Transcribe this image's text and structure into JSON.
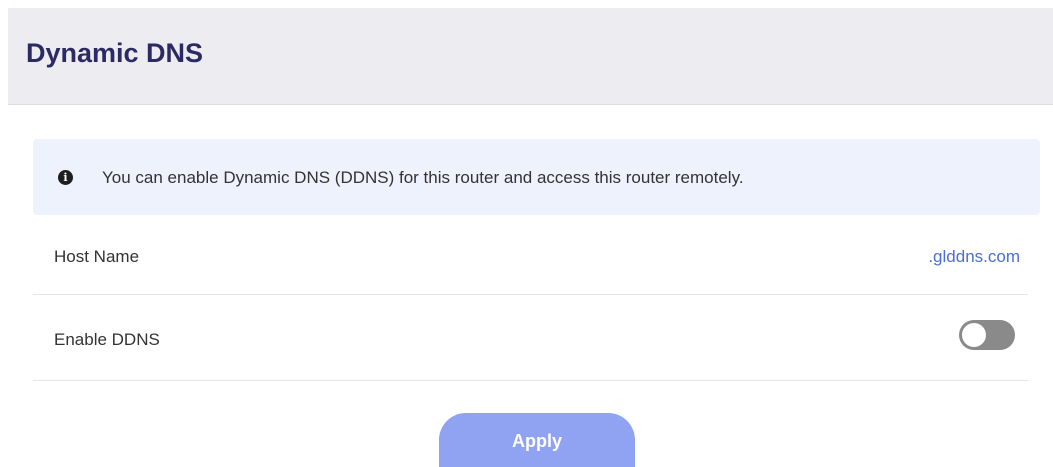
{
  "header": {
    "title": "Dynamic DNS"
  },
  "info": {
    "icon": "info-circle-icon",
    "text": "You can enable Dynamic DNS (DDNS) for this router and access this router remotely."
  },
  "host_name": {
    "label": "Host Name",
    "value": ".glddns.com"
  },
  "enable_ddns": {
    "label": "Enable DDNS",
    "enabled": false
  },
  "apply_button": {
    "label": "Apply"
  },
  "colors": {
    "header_bg": "#ececf1",
    "title": "#2b2a63",
    "info_bg": "#eef2fd",
    "link": "#4a6ed3",
    "toggle_off": "#8a8a8a",
    "apply_bg": "#8fa3f2"
  }
}
